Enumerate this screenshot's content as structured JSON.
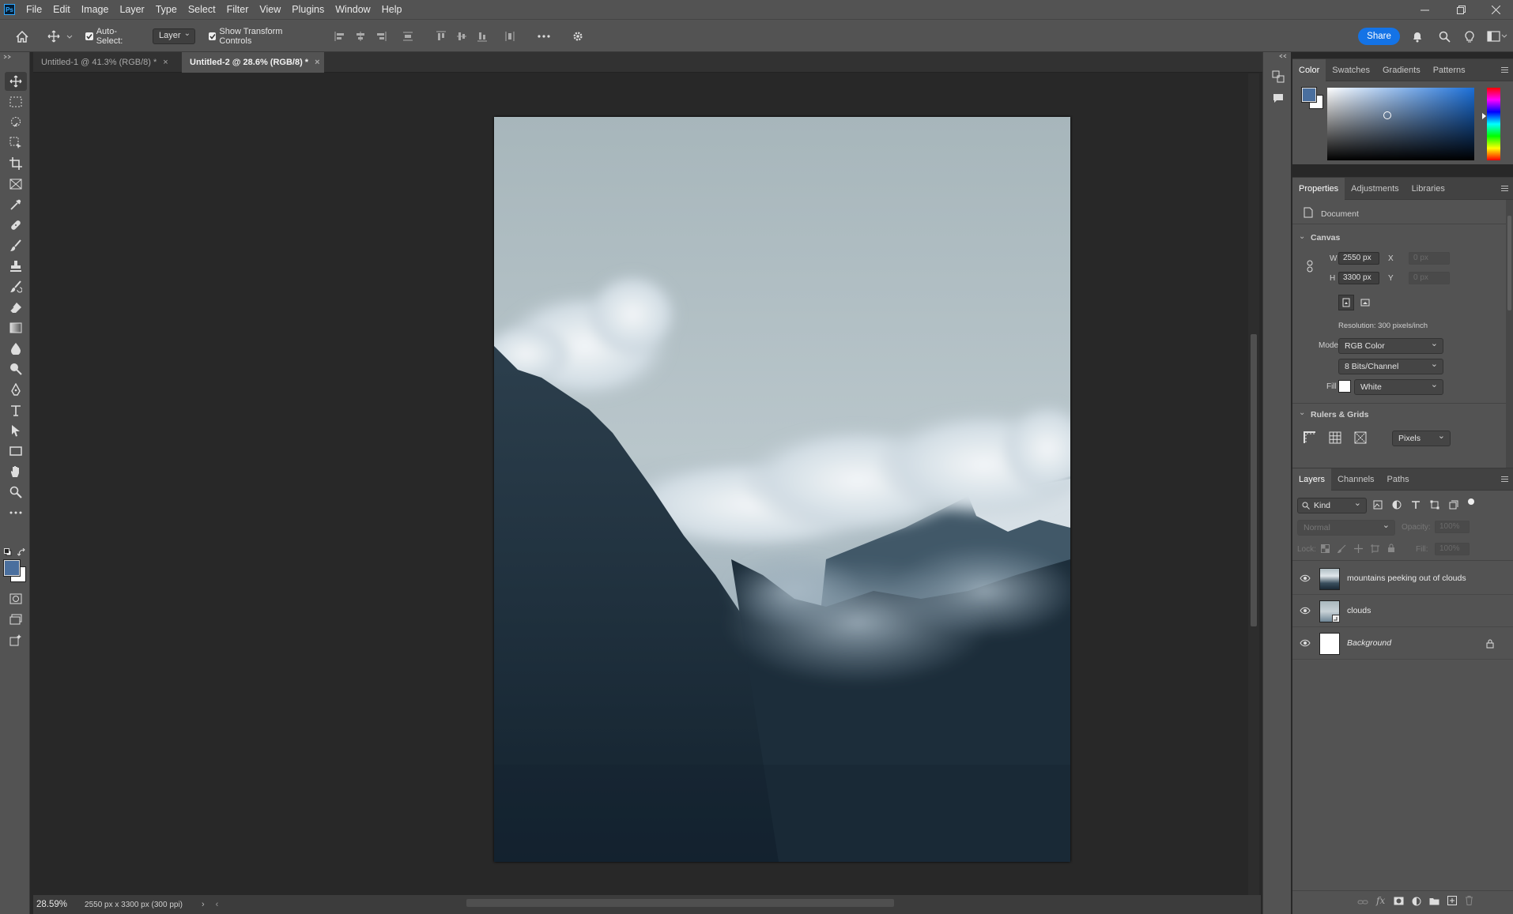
{
  "app": {
    "logo": "Ps"
  },
  "menu": [
    "File",
    "Edit",
    "Image",
    "Layer",
    "Type",
    "Select",
    "Filter",
    "View",
    "Plugins",
    "Window",
    "Help"
  ],
  "options": {
    "auto_select_label": "Auto-Select:",
    "auto_select_checked": true,
    "layer_select_value": "Layer",
    "show_transform_label": "Show Transform Controls",
    "show_transform_checked": true,
    "share_label": "Share"
  },
  "tabs": [
    {
      "label": "Untitled-1 @ 41.3% (RGB/8) *",
      "active": false
    },
    {
      "label": "Untitled-2 @ 28.6% (RGB/8) *",
      "active": true
    }
  ],
  "status": {
    "zoom": "28.59%",
    "doc_info": "2550 px x 3300 px (300 ppi)"
  },
  "color_panel": {
    "tabs": [
      "Color",
      "Swatches",
      "Gradients",
      "Patterns"
    ],
    "foreground": "#4a6f9e",
    "background": "#ffffff"
  },
  "properties": {
    "tabs": [
      "Properties",
      "Adjustments",
      "Libraries"
    ],
    "document_label": "Document",
    "canvas_section": "Canvas",
    "w_label": "W",
    "w_value": "2550 px",
    "h_label": "H",
    "h_value": "3300 px",
    "x_label": "X",
    "x_value": "0 px",
    "y_label": "Y",
    "y_value": "0 px",
    "resolution": "Resolution: 300 pixels/inch",
    "mode_label": "Mode",
    "mode_value": "RGB Color",
    "bits_value": "8 Bits/Channel",
    "fill_label": "Fill",
    "fill_value": "White",
    "rulers_section": "Rulers & Grids",
    "units_value": "Pixels"
  },
  "layers_panel": {
    "tabs": [
      "Layers",
      "Channels",
      "Paths"
    ],
    "kind_label": "Kind",
    "blend_mode": "Normal",
    "opacity_label": "Opacity:",
    "opacity_value": "100%",
    "lock_label": "Lock:",
    "fill_label": "Fill:",
    "fill_value": "100%",
    "layers": [
      {
        "name": "mountains peeking out of clouds",
        "visible": true,
        "locked": false
      },
      {
        "name": "clouds",
        "visible": true,
        "locked": false
      },
      {
        "name": "Background",
        "visible": true,
        "locked": true
      }
    ]
  }
}
